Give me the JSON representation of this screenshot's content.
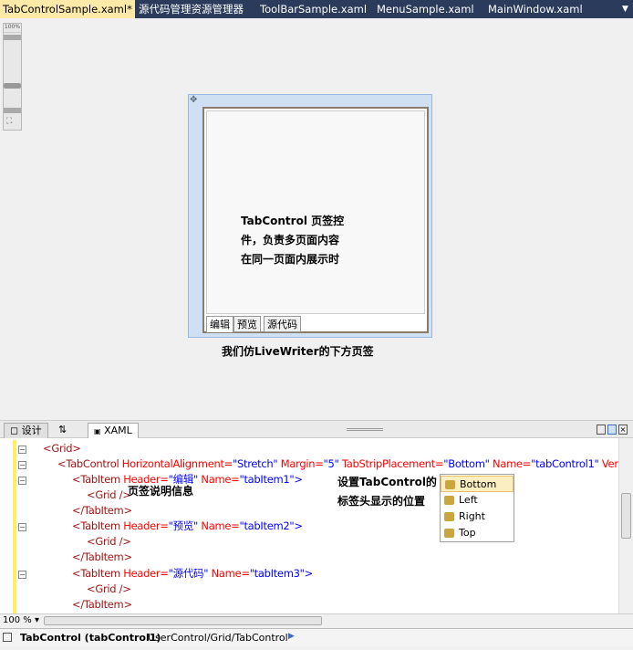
{
  "doc_tabs": [
    {
      "label": "TabControlSample.xaml*",
      "active": true
    },
    {
      "label": "源代码管理资源管理器"
    },
    {
      "label": "ToolBarSample.xaml"
    },
    {
      "label": "MenuSample.xaml"
    },
    {
      "label": "MainWindow.xaml"
    }
  ],
  "zoom_slider": {
    "label": "100%"
  },
  "designer": {
    "tab_items": [
      "编辑",
      "预览",
      "源代码"
    ],
    "content_note": [
      "TabControl 页签控",
      "件，负责多页面内容",
      "在同一页面内展示时"
    ],
    "caption": "我们仿LiveWriter的下方页签"
  },
  "pane_tabs": {
    "design": "设计",
    "swap": "⇅",
    "xaml": "XAML"
  },
  "code": {
    "l1": {
      "tag": "<Grid>"
    },
    "l2": {
      "tag": "<TabControl ",
      "a1": "HorizontalAlignment=",
      "v1": "\"Stretch\"",
      "a2": " Margin=",
      "v2": "\"5\"",
      "a3": " TabStripPlacement=",
      "v3": "\"Bottom\"",
      "a4": " Name=",
      "v4": "\"tabControl1\"",
      "a5": " Vertic"
    },
    "l3": {
      "tag": "<TabItem ",
      "a1": "Header=",
      "v1": "\"编辑\"",
      "a2": " Name=",
      "v2": "\"tabItem1\"",
      "end": ">"
    },
    "l4": {
      "tag": "<Grid />"
    },
    "l5": {
      "tag": "</TabItem>"
    },
    "l6": {
      "tag": "<TabItem ",
      "a1": "Header=",
      "v1": "\"预览\"",
      "a2": " Name=",
      "v2": "\"tabItem2\"",
      "end": ">"
    },
    "l7": {
      "tag": "<Grid />"
    },
    "l8": {
      "tag": "</TabItem>"
    },
    "l9": {
      "tag": "<TabItem ",
      "a1": "Header=",
      "v1": "\"源代码\"",
      "a2": " Name=",
      "v2": "\"tabItem3\"",
      "end": ">"
    },
    "l10": {
      "tag": "<Grid />"
    },
    "l11": {
      "tag": "</TabItem>"
    }
  },
  "annotations": {
    "tab_info": "页签说明信息",
    "placement_1": "设置TabControl的",
    "placement_2": "标签头显示的位置"
  },
  "intellisense": {
    "items": [
      "Bottom",
      "Left",
      "Right",
      "Top"
    ],
    "selected": "Bottom"
  },
  "zoom_level": "100 %",
  "status": {
    "element": "TabControl (tabControl1)",
    "path": "UserControl/Grid/TabControl"
  },
  "colors": {
    "tabbar": "#2b3b5c",
    "active_tab": "#fde9a8",
    "tag": "#a31515",
    "attr": "#ff0000",
    "value": "#0000ff"
  }
}
